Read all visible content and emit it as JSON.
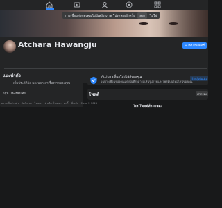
{
  "topnav": {
    "icons": [
      "home-icon",
      "video-icon",
      "friends-icon",
      "gaming-icon",
      "menu-icon"
    ],
    "active_color": "#2d88ff"
  },
  "cover": {
    "notice": {
      "text": "การเชื่อมต่อของคุณไม่มีเสถียรภาพ โปรดลองอีกครั้ง",
      "action_label": "ลอง",
      "link_label": "ไม่ใช่"
    }
  },
  "profile": {
    "name": "Atchara Hawangju",
    "add_story_label": "+ เพิ่มในสตอรี่"
  },
  "tabs": [
    "โพสต์",
    "เกี่ยวกับ",
    "เพื่อน",
    "รูปภาพ",
    "วิดีโอ"
  ],
  "intro": {
    "title": "แนะนำตัว",
    "description": "เพิ่มประวัติย่อ และบอกเล่าเรื่องราวของคุณ",
    "row_text": "อยู่ที่ ",
    "row_value": "ประเทศไทย",
    "footer": "ความเป็นส่วนตัว · ข้อกำหนด · โฆษณา · ตัวเลือกโฆษณา · คุกกี้ · เพิ่มเติม · Meta © 2024"
  },
  "shield": {
    "title": "Atchara ล็อกโปรไฟล์ของคุณ",
    "subtitle": "เฉพาะเพื่อนของคุณเท่านั้นที่สามารถเห็นรูปภาพและโพสต์บนไทม์ไลน์ของคุณ",
    "button_label": "เรียนรู้เพิ่มเติม"
  },
  "posts": {
    "title": "โพสต์",
    "filter_label": "ตัวกรอง",
    "empty_text": "ไม่มีโพสต์ที่จะแสดง"
  },
  "colors": {
    "background": "#18191a",
    "card": "#242526",
    "accent": "#2d88ff"
  }
}
